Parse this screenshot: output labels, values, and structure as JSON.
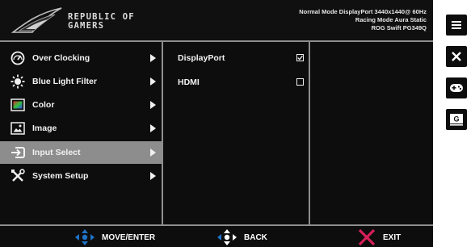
{
  "brand": {
    "name_line1": "REPUBLIC OF",
    "name_line2": "GAMERS"
  },
  "status": {
    "line1": "Normal Mode DisplayPort 3440x1440@ 60Hz",
    "line2": "Racing Mode Aura Static",
    "line3": "ROG Swift PG349Q"
  },
  "main_menu": [
    {
      "label": "Over Clocking",
      "icon": "speedometer-icon"
    },
    {
      "label": "Blue Light Filter",
      "icon": "sun-icon"
    },
    {
      "label": "Color",
      "icon": "color-palette-icon"
    },
    {
      "label": "Image",
      "icon": "image-icon"
    },
    {
      "label": "Input Select",
      "icon": "input-select-icon",
      "selected": true
    },
    {
      "label": "System Setup",
      "icon": "tools-icon"
    }
  ],
  "sub_menu": [
    {
      "label": "DisplayPort",
      "checked": true
    },
    {
      "label": "HDMI",
      "checked": false
    }
  ],
  "footer": {
    "move_label": "MOVE/ENTER",
    "back_label": "BACK",
    "exit_label": "EXIT"
  },
  "side_buttons": [
    "menu-icon",
    "close-icon",
    "gamepad-icon",
    "gameplus-icon"
  ],
  "side_gameplus_letter": "G",
  "colors": {
    "osd_background": "#0d0d0d",
    "selected_row": "#8d8d8d",
    "divider": "#8e8e8e",
    "nav_blue": "#1e73c8",
    "exit_red": "#d81f5a"
  }
}
